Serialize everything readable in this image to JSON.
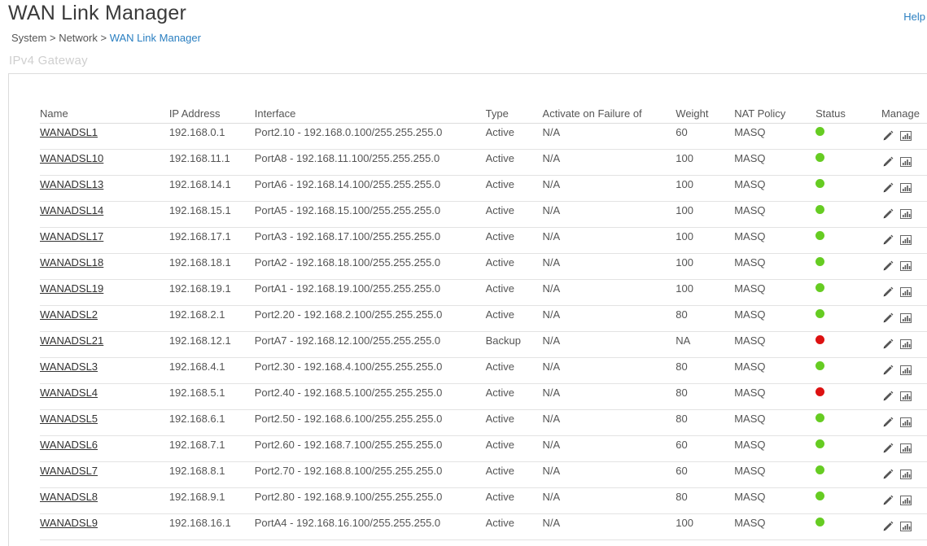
{
  "header": {
    "title": "WAN Link Manager",
    "help_label": "Help"
  },
  "breadcrumb": {
    "items": [
      "System",
      "Network",
      "WAN Link Manager"
    ],
    "separator": ">"
  },
  "section": {
    "title": "IPv4 Gateway"
  },
  "table": {
    "columns": [
      "Name",
      "IP Address",
      "Interface",
      "Type",
      "Activate on Failure of",
      "Weight",
      "NAT Policy",
      "Status",
      "Manage"
    ],
    "rows": [
      {
        "name": "WANADSL1",
        "ip": "192.168.0.1",
        "interface": "Port2.10 - 192.168.0.100/255.255.255.0",
        "type": "Active",
        "failover": "N/A",
        "weight": "60",
        "nat": "MASQ",
        "status": "up"
      },
      {
        "name": "WANADSL10",
        "ip": "192.168.11.1",
        "interface": "PortA8 - 192.168.11.100/255.255.255.0",
        "type": "Active",
        "failover": "N/A",
        "weight": "100",
        "nat": "MASQ",
        "status": "up"
      },
      {
        "name": "WANADSL13",
        "ip": "192.168.14.1",
        "interface": "PortA6 - 192.168.14.100/255.255.255.0",
        "type": "Active",
        "failover": "N/A",
        "weight": "100",
        "nat": "MASQ",
        "status": "up"
      },
      {
        "name": "WANADSL14",
        "ip": "192.168.15.1",
        "interface": "PortA5 - 192.168.15.100/255.255.255.0",
        "type": "Active",
        "failover": "N/A",
        "weight": "100",
        "nat": "MASQ",
        "status": "up"
      },
      {
        "name": "WANADSL17",
        "ip": "192.168.17.1",
        "interface": "PortA3 - 192.168.17.100/255.255.255.0",
        "type": "Active",
        "failover": "N/A",
        "weight": "100",
        "nat": "MASQ",
        "status": "up"
      },
      {
        "name": "WANADSL18",
        "ip": "192.168.18.1",
        "interface": "PortA2 - 192.168.18.100/255.255.255.0",
        "type": "Active",
        "failover": "N/A",
        "weight": "100",
        "nat": "MASQ",
        "status": "up"
      },
      {
        "name": "WANADSL19",
        "ip": "192.168.19.1",
        "interface": "PortA1 - 192.168.19.100/255.255.255.0",
        "type": "Active",
        "failover": "N/A",
        "weight": "100",
        "nat": "MASQ",
        "status": "up"
      },
      {
        "name": "WANADSL2",
        "ip": "192.168.2.1",
        "interface": "Port2.20 - 192.168.2.100/255.255.255.0",
        "type": "Active",
        "failover": "N/A",
        "weight": "80",
        "nat": "MASQ",
        "status": "up"
      },
      {
        "name": "WANADSL21",
        "ip": "192.168.12.1",
        "interface": "PortA7 - 192.168.12.100/255.255.255.0",
        "type": "Backup",
        "failover": "N/A",
        "weight": "NA",
        "nat": "MASQ",
        "status": "down"
      },
      {
        "name": "WANADSL3",
        "ip": "192.168.4.1",
        "interface": "Port2.30 - 192.168.4.100/255.255.255.0",
        "type": "Active",
        "failover": "N/A",
        "weight": "80",
        "nat": "MASQ",
        "status": "up"
      },
      {
        "name": "WANADSL4",
        "ip": "192.168.5.1",
        "interface": "Port2.40 - 192.168.5.100/255.255.255.0",
        "type": "Active",
        "failover": "N/A",
        "weight": "80",
        "nat": "MASQ",
        "status": "down"
      },
      {
        "name": "WANADSL5",
        "ip": "192.168.6.1",
        "interface": "Port2.50 - 192.168.6.100/255.255.255.0",
        "type": "Active",
        "failover": "N/A",
        "weight": "80",
        "nat": "MASQ",
        "status": "up"
      },
      {
        "name": "WANADSL6",
        "ip": "192.168.7.1",
        "interface": "Port2.60 - 192.168.7.100/255.255.255.0",
        "type": "Active",
        "failover": "N/A",
        "weight": "60",
        "nat": "MASQ",
        "status": "up"
      },
      {
        "name": "WANADSL7",
        "ip": "192.168.8.1",
        "interface": "Port2.70 - 192.168.8.100/255.255.255.0",
        "type": "Active",
        "failover": "N/A",
        "weight": "60",
        "nat": "MASQ",
        "status": "up"
      },
      {
        "name": "WANADSL8",
        "ip": "192.168.9.1",
        "interface": "Port2.80 - 192.168.9.100/255.255.255.0",
        "type": "Active",
        "failover": "N/A",
        "weight": "80",
        "nat": "MASQ",
        "status": "up"
      },
      {
        "name": "WANADSL9",
        "ip": "192.168.16.1",
        "interface": "PortA4 - 192.168.16.100/255.255.255.0",
        "type": "Active",
        "failover": "N/A",
        "weight": "100",
        "nat": "MASQ",
        "status": "up"
      }
    ]
  },
  "icons": {
    "edit": "pencil-icon",
    "stats": "bar-chart-icon"
  },
  "colors": {
    "status_up": "#66cc22",
    "status_down": "#dd1111",
    "link": "#2a7fc1"
  }
}
